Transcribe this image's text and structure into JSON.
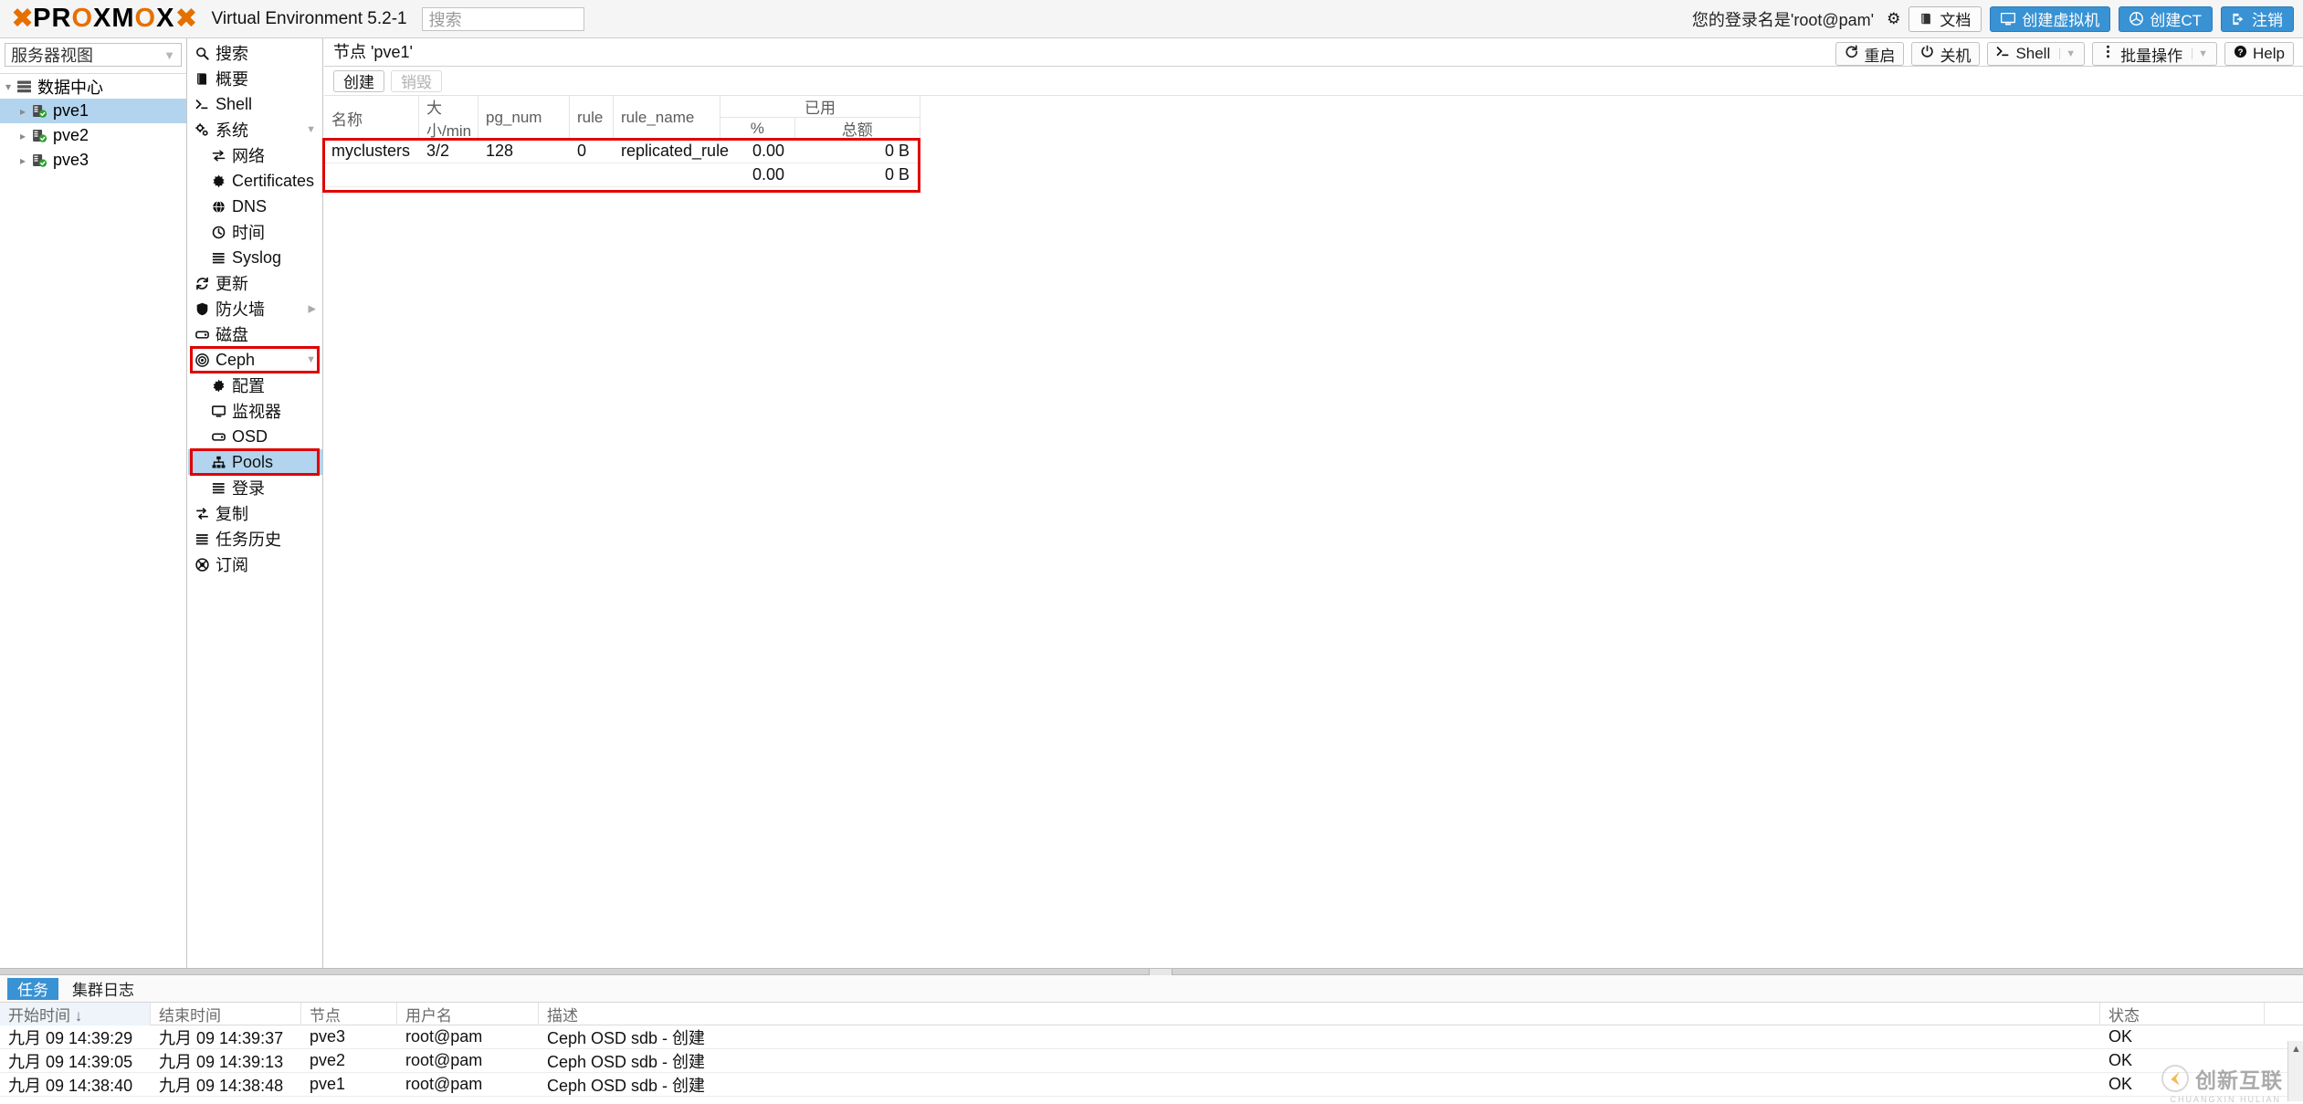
{
  "header": {
    "logo_text": "PROXMOX",
    "product": "Virtual Environment 5.2-1",
    "search_placeholder": "搜索",
    "username": "您的登录名是'root@pam'",
    "buttons": [
      {
        "label": "文档",
        "icon": "book-icon",
        "style": "plain"
      },
      {
        "label": "创建虚拟机",
        "icon": "monitor-icon",
        "style": "blue"
      },
      {
        "label": "创建CT",
        "icon": "cube-icon",
        "style": "blue"
      },
      {
        "label": "注销",
        "icon": "logout-icon",
        "style": "blue"
      }
    ]
  },
  "tree": {
    "view_label": "服务器视图",
    "root": {
      "label": "数据中心",
      "icon": "datacenter-icon"
    },
    "nodes": [
      {
        "label": "pve1",
        "icon": "server-icon",
        "selected": true
      },
      {
        "label": "pve2",
        "icon": "server-icon",
        "selected": false
      },
      {
        "label": "pve3",
        "icon": "server-icon",
        "selected": false
      }
    ]
  },
  "menu": {
    "items": [
      {
        "label": "搜索",
        "icon": "search-icon",
        "indent": false,
        "expander": "",
        "selected": false,
        "highlight": ""
      },
      {
        "label": "概要",
        "icon": "book-icon",
        "indent": false,
        "expander": "",
        "selected": false,
        "highlight": ""
      },
      {
        "label": "Shell",
        "icon": "terminal-icon",
        "indent": false,
        "expander": "",
        "selected": false,
        "highlight": ""
      },
      {
        "label": "系统",
        "icon": "gears-icon",
        "indent": false,
        "expander": "down",
        "selected": false,
        "highlight": ""
      },
      {
        "label": "网络",
        "icon": "network-icon",
        "indent": true,
        "expander": "",
        "selected": false,
        "highlight": ""
      },
      {
        "label": "Certificates",
        "icon": "certificate-icon",
        "indent": true,
        "expander": "",
        "selected": false,
        "highlight": ""
      },
      {
        "label": "DNS",
        "icon": "globe-icon",
        "indent": true,
        "expander": "",
        "selected": false,
        "highlight": ""
      },
      {
        "label": "时间",
        "icon": "clock-icon",
        "indent": true,
        "expander": "",
        "selected": false,
        "highlight": ""
      },
      {
        "label": "Syslog",
        "icon": "list-icon",
        "indent": true,
        "expander": "",
        "selected": false,
        "highlight": ""
      },
      {
        "label": "更新",
        "icon": "refresh-icon",
        "indent": false,
        "expander": "",
        "selected": false,
        "highlight": ""
      },
      {
        "label": "防火墙",
        "icon": "shield-icon",
        "indent": false,
        "expander": "right",
        "selected": false,
        "highlight": ""
      },
      {
        "label": "磁盘",
        "icon": "disk-icon",
        "indent": false,
        "expander": "",
        "selected": false,
        "highlight": ""
      },
      {
        "label": "Ceph",
        "icon": "ceph-icon",
        "indent": false,
        "expander": "down",
        "selected": false,
        "highlight": "red"
      },
      {
        "label": "配置",
        "icon": "gear-icon",
        "indent": true,
        "expander": "",
        "selected": false,
        "highlight": ""
      },
      {
        "label": "监视器",
        "icon": "monitor-icon",
        "indent": true,
        "expander": "",
        "selected": false,
        "highlight": ""
      },
      {
        "label": "OSD",
        "icon": "disk-icon",
        "indent": true,
        "expander": "",
        "selected": false,
        "highlight": ""
      },
      {
        "label": "Pools",
        "icon": "sitemap-icon",
        "indent": true,
        "expander": "",
        "selected": true,
        "highlight": "red"
      },
      {
        "label": "登录",
        "icon": "list-icon",
        "indent": true,
        "expander": "",
        "selected": false,
        "highlight": ""
      },
      {
        "label": "复制",
        "icon": "replicate-icon",
        "indent": false,
        "expander": "",
        "selected": false,
        "highlight": ""
      },
      {
        "label": "任务历史",
        "icon": "list-icon",
        "indent": false,
        "expander": "",
        "selected": false,
        "highlight": ""
      },
      {
        "label": "订阅",
        "icon": "support-icon",
        "indent": false,
        "expander": "",
        "selected": false,
        "highlight": ""
      }
    ]
  },
  "content": {
    "breadcrumb": "节点 'pve1'",
    "toolbar_buttons": [
      {
        "label": "重启",
        "icon": "restart-icon",
        "split": false
      },
      {
        "label": "关机",
        "icon": "power-icon",
        "split": false
      },
      {
        "label": "Shell",
        "icon": "terminal-icon",
        "split": true
      },
      {
        "label": "批量操作",
        "icon": "kebab-icon",
        "split": true
      },
      {
        "label": "Help",
        "icon": "help-icon",
        "split": false
      }
    ],
    "panel_buttons": [
      {
        "label": "创建",
        "disabled": false
      },
      {
        "label": "销毁",
        "disabled": true
      }
    ],
    "table": {
      "columns": {
        "name": "名称",
        "size": "大小/min",
        "pg_num": "pg_num",
        "rule": "rule",
        "rule_name": "rule_name",
        "used_group": "已用",
        "used_pct": "%",
        "used_total": "总额"
      },
      "rows": [
        {
          "name": "myclusters",
          "size": "3/2",
          "pg_num": "128",
          "rule": "0",
          "rule_name": "replicated_rule",
          "used_pct": "0.00",
          "used_total": "0 B"
        },
        {
          "name": "",
          "size": "",
          "pg_num": "",
          "rule": "",
          "rule_name": "",
          "used_pct": "0.00",
          "used_total": "0 B"
        }
      ]
    }
  },
  "tasks": {
    "tabs": [
      {
        "label": "任务",
        "active": true
      },
      {
        "label": "集群日志",
        "active": false
      }
    ],
    "columns": {
      "start": "开始时间 ↓",
      "end": "结束时间",
      "node": "节点",
      "user": "用户名",
      "desc": "描述",
      "status": "状态"
    },
    "rows": [
      {
        "start": "九月 09 14:39:29",
        "end": "九月 09 14:39:37",
        "node": "pve3",
        "user": "root@pam",
        "desc": "Ceph OSD sdb - 创建",
        "status": "OK"
      },
      {
        "start": "九月 09 14:39:05",
        "end": "九月 09 14:39:13",
        "node": "pve2",
        "user": "root@pam",
        "desc": "Ceph OSD sdb - 创建",
        "status": "OK"
      },
      {
        "start": "九月 09 14:38:40",
        "end": "九月 09 14:38:48",
        "node": "pve1",
        "user": "root@pam",
        "desc": "Ceph OSD sdb - 创建",
        "status": "OK"
      }
    ]
  },
  "watermark": {
    "text": "创新互联",
    "sub": "CHUANGXIN HULIAN"
  },
  "colors": {
    "accent": "#3892d4",
    "brand_orange": "#e57000",
    "highlight": "#e00000",
    "selection": "#b3d4ef"
  }
}
